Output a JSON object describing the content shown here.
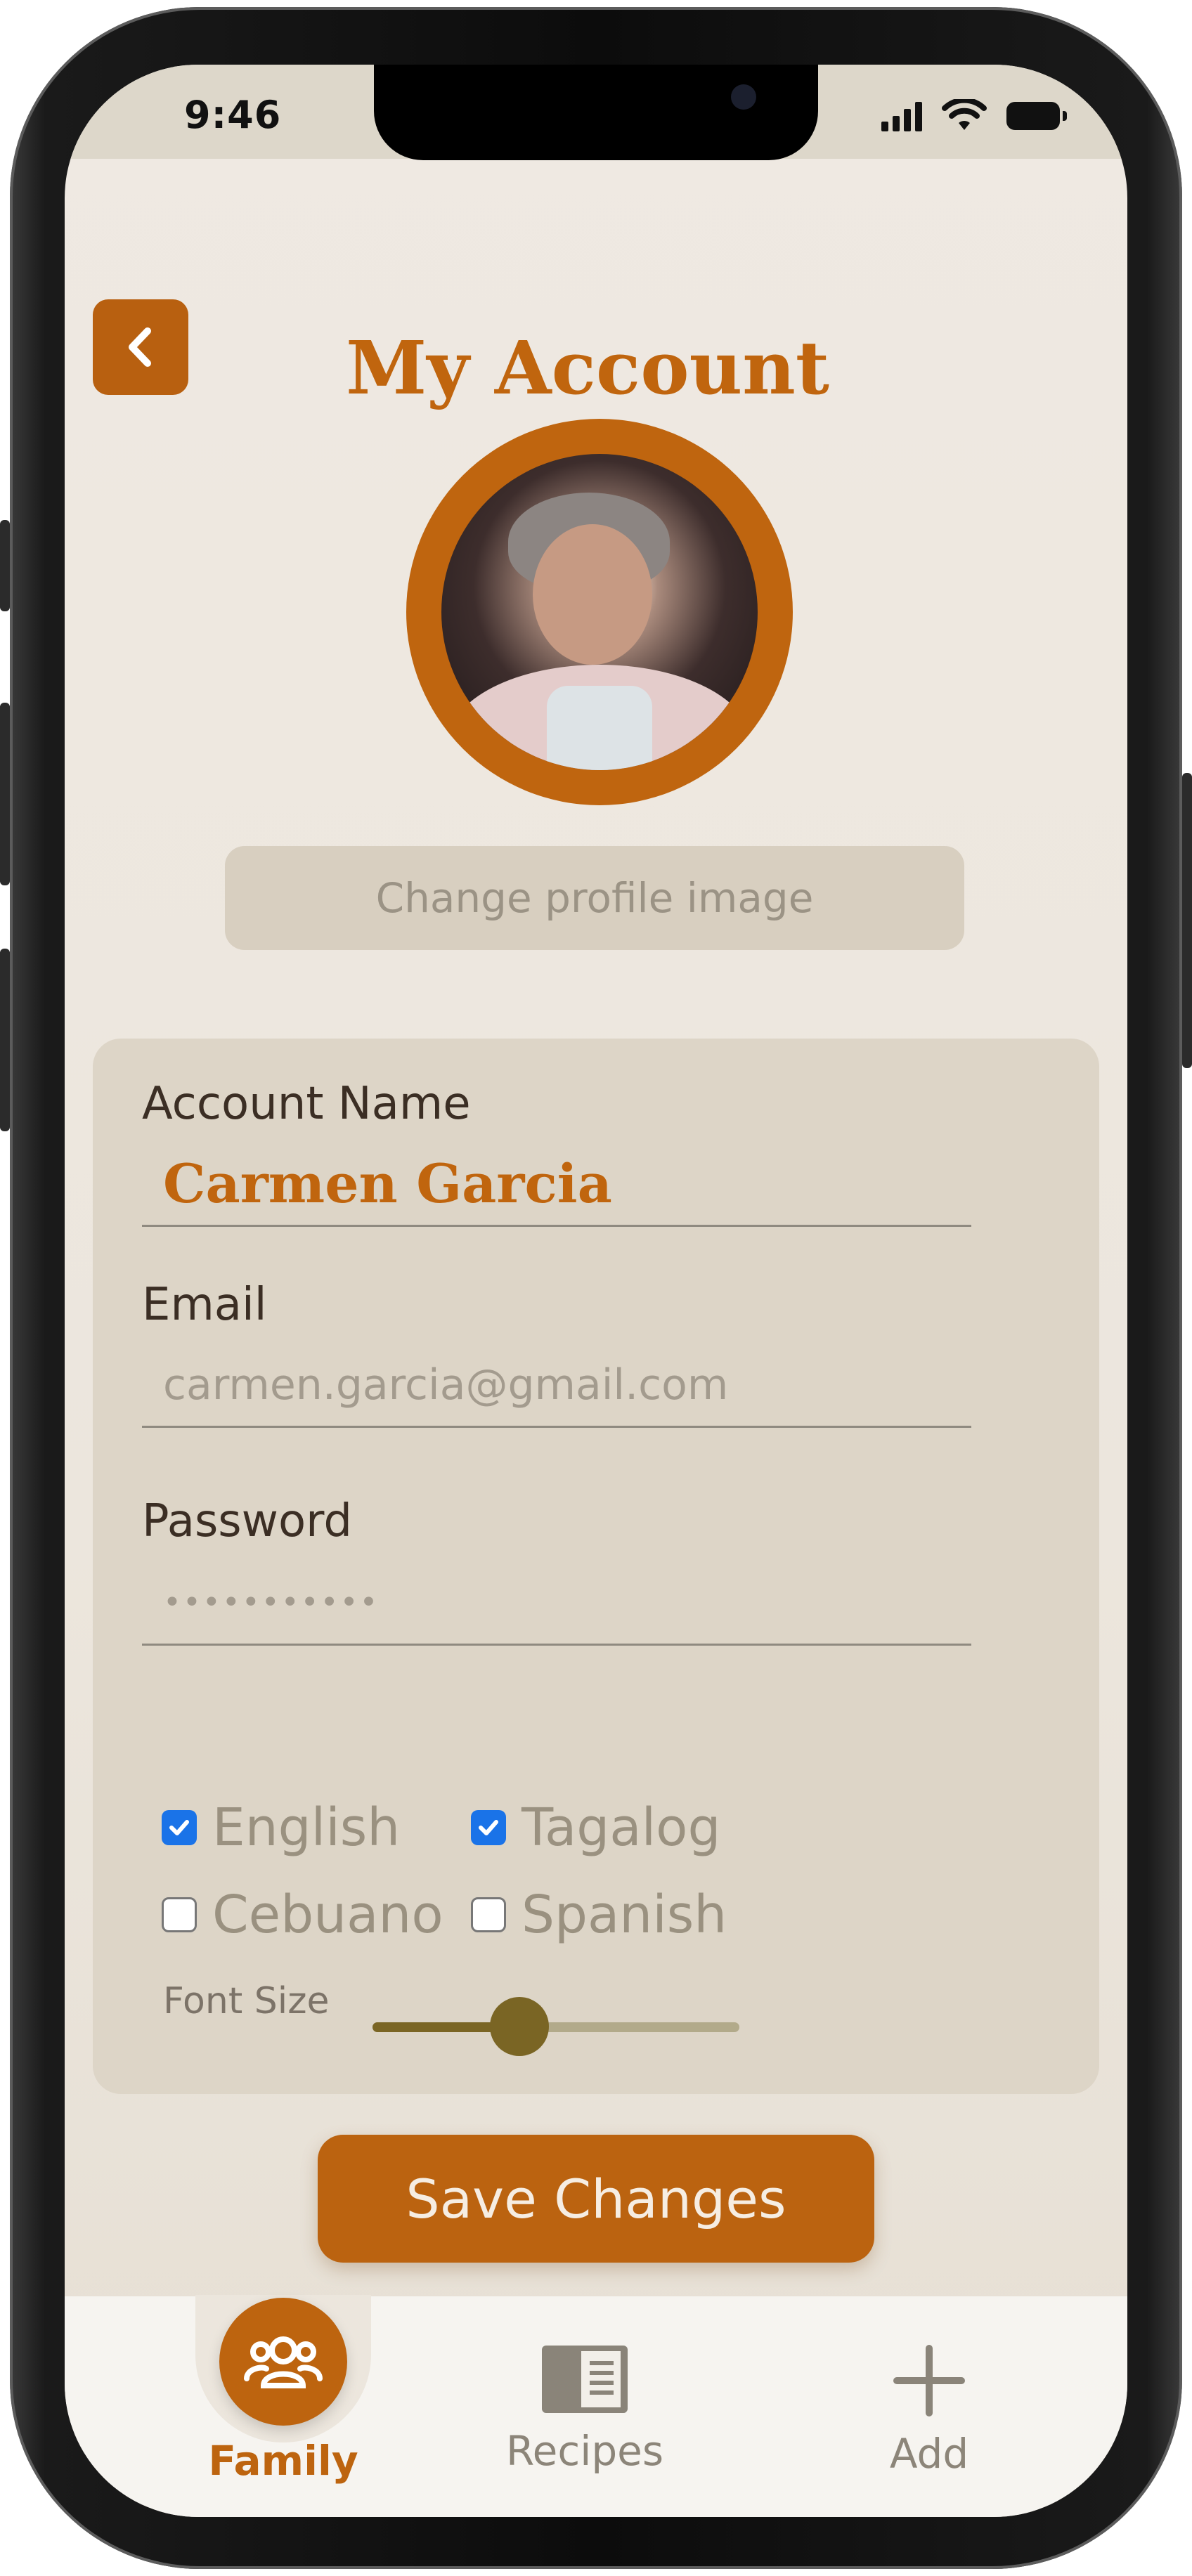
{
  "status_bar": {
    "time": "9:46"
  },
  "header": {
    "title": "My Account",
    "back_icon": "chevron-left-icon"
  },
  "profile": {
    "change_image_label": "Change profile image"
  },
  "form": {
    "account_name": {
      "label": "Account Name",
      "value": "Carmen Garcia"
    },
    "email": {
      "label": "Email",
      "value": "carmen.garcia@gmail.com"
    },
    "password": {
      "label": "Password",
      "value": "•••••••••••"
    },
    "languages": [
      {
        "label": "English",
        "checked": true
      },
      {
        "label": "Tagalog",
        "checked": true
      },
      {
        "label": "Cebuano",
        "checked": false
      },
      {
        "label": "Spanish",
        "checked": false
      }
    ],
    "font_size": {
      "label": "Font Size",
      "level": 0.4
    }
  },
  "actions": {
    "save_label": "Save Changes"
  },
  "tabbar": {
    "items": [
      {
        "label": "Family",
        "icon": "users-icon",
        "active": true
      },
      {
        "label": "Recipes",
        "icon": "book-icon",
        "active": false
      },
      {
        "label": "Add",
        "icon": "plus-icon",
        "active": false
      }
    ]
  },
  "colors": {
    "accent": "#bb6310",
    "background": "#ece6dd",
    "card": "#ddd5c7",
    "slider": "#7a6524"
  }
}
